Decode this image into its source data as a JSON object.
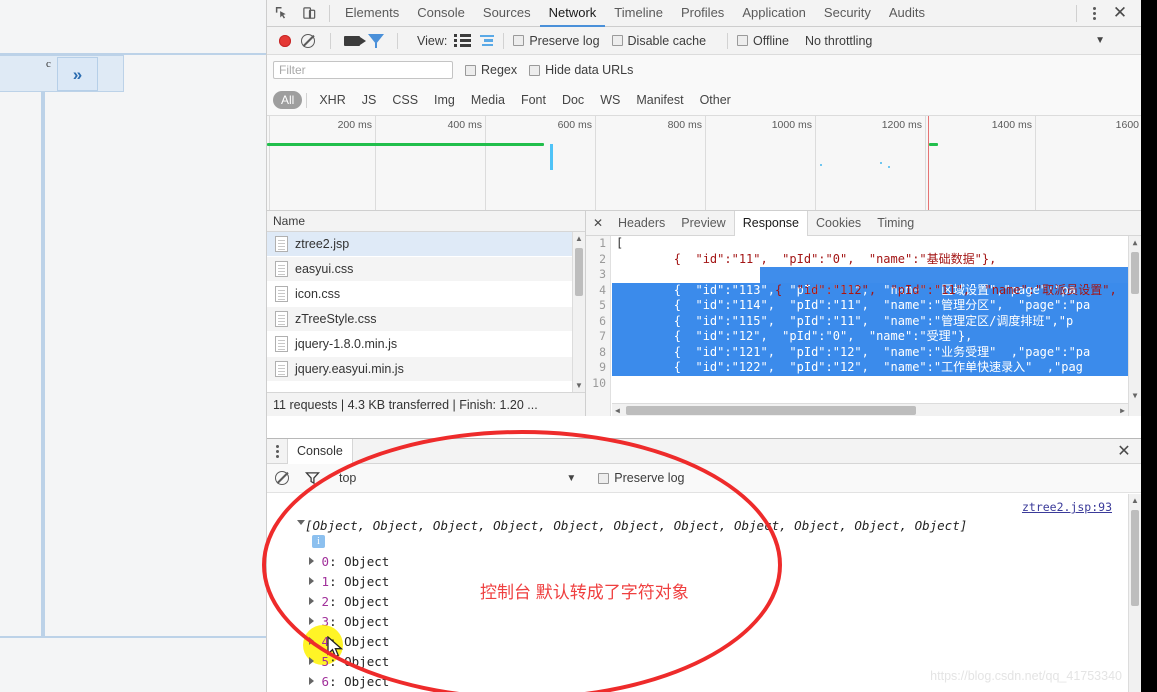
{
  "page_panel": {
    "label": "c",
    "expand_icon": "chevron-double-right-icon"
  },
  "devtools": {
    "tabs": [
      {
        "label": "Elements",
        "active": false
      },
      {
        "label": "Console",
        "active": false
      },
      {
        "label": "Sources",
        "active": false
      },
      {
        "label": "Network",
        "active": true
      },
      {
        "label": "Timeline",
        "active": false
      },
      {
        "label": "Profiles",
        "active": false
      },
      {
        "label": "Application",
        "active": false
      },
      {
        "label": "Security",
        "active": false
      },
      {
        "label": "Audits",
        "active": false
      }
    ],
    "inspect_icon": "inspect-element-icon",
    "device_icon": "device-toolbar-icon",
    "more_icon": "more-vertical-icon",
    "close_icon": "close-icon"
  },
  "network_toolbar": {
    "record_icon": "record-button-icon",
    "clear_icon": "clear-icon",
    "capture_screenshots_icon": "camera-icon",
    "filter_icon": "filter-funnel-icon",
    "view_label": "View:",
    "list_view_icon": "list-view-icon",
    "waterfall_view_icon": "waterfall-view-icon",
    "preserve_log": "Preserve log",
    "disable_cache": "Disable cache",
    "offline": "Offline",
    "throttling": "No throttling",
    "throttling_caret": "chevron-down-icon"
  },
  "filter_row": {
    "placeholder": "Filter",
    "value": "",
    "regex": "Regex",
    "hide_data_urls": "Hide data URLs"
  },
  "type_filters": [
    {
      "label": "All",
      "active": true
    },
    {
      "label": "XHR",
      "active": false
    },
    {
      "label": "JS",
      "active": false
    },
    {
      "label": "CSS",
      "active": false
    },
    {
      "label": "Img",
      "active": false
    },
    {
      "label": "Media",
      "active": false
    },
    {
      "label": "Font",
      "active": false
    },
    {
      "label": "Doc",
      "active": false
    },
    {
      "label": "WS",
      "active": false
    },
    {
      "label": "Manifest",
      "active": false
    },
    {
      "label": "Other",
      "active": false
    }
  ],
  "overview": {
    "ticks": [
      "200 ms",
      "400 ms",
      "600 ms",
      "800 ms",
      "1000 ms",
      "1200 ms",
      "1400 ms",
      "1600 "
    ]
  },
  "requests_panel": {
    "column_header": "Name",
    "rows": [
      {
        "name": "ztree2.jsp",
        "selected": true
      },
      {
        "name": "easyui.css",
        "selected": false
      },
      {
        "name": "icon.css",
        "selected": false
      },
      {
        "name": "zTreeStyle.css",
        "selected": false
      },
      {
        "name": "jquery-1.8.0.min.js",
        "selected": false
      },
      {
        "name": "jquery.easyui.min.js",
        "selected": false
      }
    ],
    "summary": "11 requests  |  4.3 KB transferred  |  Finish: 1.20 ...",
    "scroll_up_icon": "chevron-up-icon",
    "scroll_down_icon": "chevron-down-icon"
  },
  "response_panel": {
    "close_icon": "close-icon",
    "tabs": [
      {
        "label": "Headers",
        "active": false
      },
      {
        "label": "Preview",
        "active": false
      },
      {
        "label": "Response",
        "active": true
      },
      {
        "label": "Cookies",
        "active": false
      },
      {
        "label": "Timing",
        "active": false
      }
    ],
    "line_numbers": [
      "1",
      "2",
      "3",
      "4",
      "5",
      "6",
      "7",
      "8",
      "9",
      "10"
    ],
    "lines": [
      {
        "text": "[",
        "selected": false
      },
      {
        "text": "        {  \"id\":\"11\",  \"pId\":\"0\",  \"name\":\"基础数据\"},",
        "selected": false
      },
      {
        "text": "        {  \"id\":\"112\",  \"pId\":\"11\",  \"name\":\"取派员设置\",   \"page\":",
        "selected": "partial"
      },
      {
        "text": "        {  \"id\":\"113\",  \"pId\":\"11\",  \"name\":\"区域设置\",\"page\":\"pa",
        "selected": true
      },
      {
        "text": "        {  \"id\":\"114\",  \"pId\":\"11\",  \"name\":\"管理分区\",  \"page\":\"pa",
        "selected": true
      },
      {
        "text": "        {  \"id\":\"115\",  \"pId\":\"11\",  \"name\":\"管理定区/调度排班\",\"p",
        "selected": true
      },
      {
        "text": "        {  \"id\":\"12\",  \"pId\":\"0\",  \"name\":\"受理\"},",
        "selected": true
      },
      {
        "text": "        {  \"id\":\"121\",  \"pId\":\"12\",  \"name\":\"业务受理\"  ,\"page\":\"pa",
        "selected": true
      },
      {
        "text": "        {  \"id\":\"122\",  \"pId\":\"12\",  \"name\":\"工作单快速录入\"  ,\"pag",
        "selected": true
      },
      {
        "text": "",
        "selected": false
      }
    ]
  },
  "console_drawer": {
    "more_icon": "more-vertical-icon",
    "tab_label": "Console",
    "close_icon": "close-icon",
    "clear_icon": "clear-console-icon",
    "filter_icon": "filter-funnel-icon",
    "context": "top",
    "context_caret": "chevron-down-icon",
    "preserve_log": "Preserve log",
    "source_link": "ztree2.jsp:93",
    "log_summary": "[Object, Object, Object, Object, Object, Object, Object, Object, Object, Object, Object]",
    "info_badge": "i",
    "objects": [
      {
        "index": "0",
        "value": "Object"
      },
      {
        "index": "1",
        "value": "Object"
      },
      {
        "index": "2",
        "value": "Object"
      },
      {
        "index": "3",
        "value": "Object"
      },
      {
        "index": "4",
        "value": "Object"
      },
      {
        "index": "5",
        "value": "Object"
      },
      {
        "index": "6",
        "value": "Object"
      }
    ]
  },
  "annotations": {
    "text": "控制台    默认转成了字符对象",
    "color": "#ef4040",
    "highlight_color": "#fff200"
  },
  "watermark": "https://blog.csdn.net/qq_41753340"
}
